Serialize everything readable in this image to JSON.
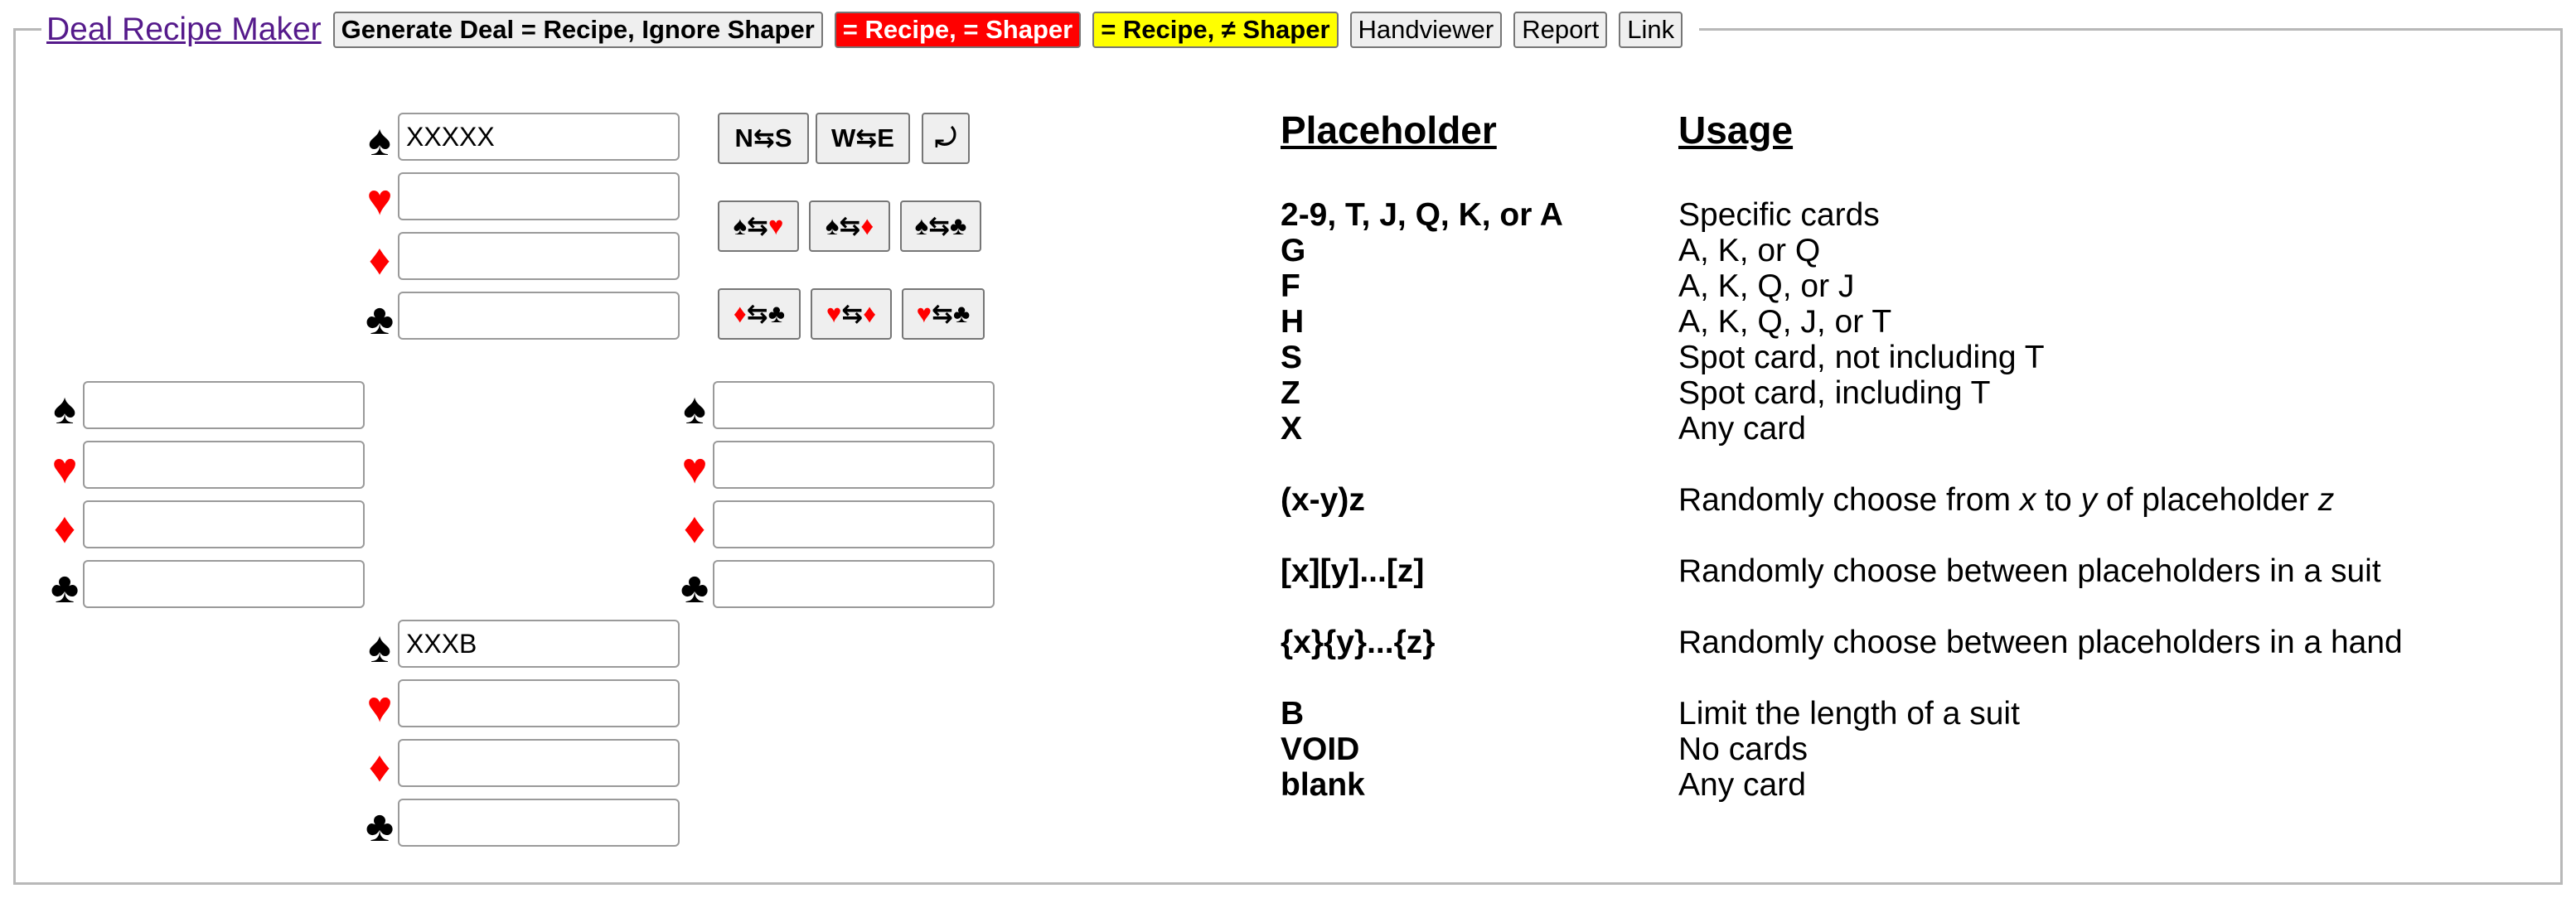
{
  "toolbar": {
    "app_link": "Deal Recipe Maker",
    "buttons": [
      "Generate Deal = Recipe, Ignore Shaper",
      "= Recipe, = Shaper",
      "= Recipe, ≠ Shaper",
      "Handviewer",
      "Report",
      "Link"
    ]
  },
  "suits": {
    "spade": "♠",
    "heart": "♥",
    "diamond": "♦",
    "club": "♣"
  },
  "hands": {
    "north": {
      "spades": "XXXXX",
      "hearts": "",
      "diamonds": "",
      "clubs": ""
    },
    "west": {
      "spades": "",
      "hearts": "",
      "diamonds": "",
      "clubs": ""
    },
    "east": {
      "spades": "",
      "hearts": "",
      "diamonds": "",
      "clubs": ""
    },
    "south": {
      "spades": "XXXB",
      "hearts": "",
      "diamonds": "",
      "clubs": ""
    }
  },
  "swap": {
    "ns": "N⇆S",
    "we": "W⇆E",
    "rotate": "⤾",
    "arrow": "⇆"
  },
  "colors": {
    "red_suit": "#ff0000",
    "red_button": "#ff0000",
    "yellow_button": "#ffff00",
    "link": "#551a8b"
  },
  "help": {
    "header_placeholder": "Placeholder",
    "header_usage": "Usage",
    "group1": [
      {
        "p": "2-9, T, J, Q, K, or A",
        "u": "Specific cards"
      },
      {
        "p": "G",
        "u": "A, K, or Q"
      },
      {
        "p": "F",
        "u": "A, K, Q, or J"
      },
      {
        "p": "H",
        "u": "A, K, Q, J, or T"
      },
      {
        "p": "S",
        "u": "Spot card, not including T"
      },
      {
        "p": "Z",
        "u": "Spot card, including T"
      },
      {
        "p": "X",
        "u": "Any card"
      }
    ],
    "range": {
      "p": "(x-y)z",
      "u1": "Randomly choose from ",
      "x": "x",
      "u2": " to ",
      "y": "y",
      "u3": " of placeholder ",
      "z": "z"
    },
    "suit_choice": {
      "p": "[x][y]...[z]",
      "u": "Randomly choose between placeholders in a suit"
    },
    "hand_choice": {
      "p": "{x}{y}...{z}",
      "u": "Randomly choose between placeholders in a hand"
    },
    "group2": [
      {
        "p": "B",
        "u": "Limit the length of a suit"
      },
      {
        "p": "VOID",
        "u": "No cards"
      },
      {
        "p": "blank",
        "u": "Any card"
      }
    ]
  }
}
